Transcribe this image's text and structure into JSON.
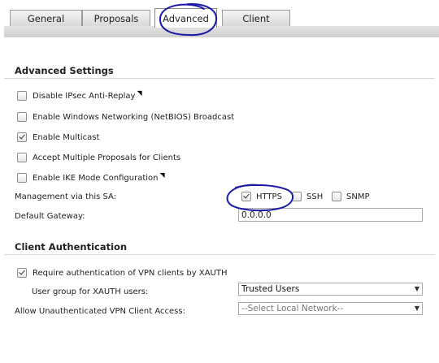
{
  "tabs": [
    {
      "label": "General",
      "active": false
    },
    {
      "label": "Proposals",
      "active": false
    },
    {
      "label": "Advanced",
      "active": true
    },
    {
      "label": "Client",
      "active": false
    }
  ],
  "advanced_settings": {
    "title": "Advanced Settings",
    "options": [
      {
        "label": "Disable IPsec Anti-Replay",
        "checked": false,
        "has_note_mark": true
      },
      {
        "label": "Enable Windows Networking (NetBIOS) Broadcast",
        "checked": false,
        "has_note_mark": false
      },
      {
        "label": "Enable Multicast",
        "checked": true,
        "has_note_mark": false
      },
      {
        "label": "Accept Multiple Proposals for Clients",
        "checked": false,
        "has_note_mark": false
      },
      {
        "label": "Enable IKE Mode Configuration",
        "checked": false,
        "has_note_mark": true
      }
    ],
    "management": {
      "label": "Management via this SA:",
      "https": {
        "label": "HTTPS",
        "checked": true
      },
      "ssh": {
        "label": "SSH",
        "checked": false
      },
      "snmp": {
        "label": "SNMP",
        "checked": false
      }
    },
    "default_gateway": {
      "label": "Default Gateway:",
      "value": "0.0.0.0"
    },
    "note_mark": "◥"
  },
  "client_auth": {
    "title": "Client Authentication",
    "require_xauth": {
      "label": "Require authentication of VPN clients by XAUTH",
      "checked": true
    },
    "user_group": {
      "label": "User group for XAUTH users:",
      "selected": "Trusted Users"
    },
    "unauth_access": {
      "label": "Allow Unauthenticated VPN Client Access:",
      "selected": "--Select Local Network--"
    },
    "dropdown_arrow": "▼"
  },
  "annotation_color": "#1a1aa6"
}
